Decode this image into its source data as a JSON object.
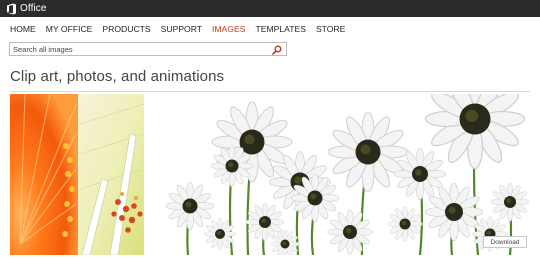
{
  "header": {
    "brand": "Office",
    "logo_icon": "office-logo-icon",
    "background": "#2b2b2b"
  },
  "nav": {
    "items": [
      {
        "label": "HOME"
      },
      {
        "label": "MY OFFICE"
      },
      {
        "label": "PRODUCTS"
      },
      {
        "label": "SUPPORT"
      },
      {
        "label": "IMAGES",
        "active": true
      },
      {
        "label": "TEMPLATES"
      },
      {
        "label": "STORE"
      }
    ],
    "active_color": "#c43e1c"
  },
  "search": {
    "placeholder": "Search all images",
    "icon": "search-icon",
    "icon_color": "#c43e1c"
  },
  "main": {
    "title": "Clip art, photos, and animations"
  },
  "gallery": {
    "images": [
      {
        "name": "orange-gerbera-closeup"
      },
      {
        "name": "yellow-poinsettia-sketch"
      },
      {
        "name": "white-daisies-field"
      }
    ],
    "download_label": "Download"
  }
}
